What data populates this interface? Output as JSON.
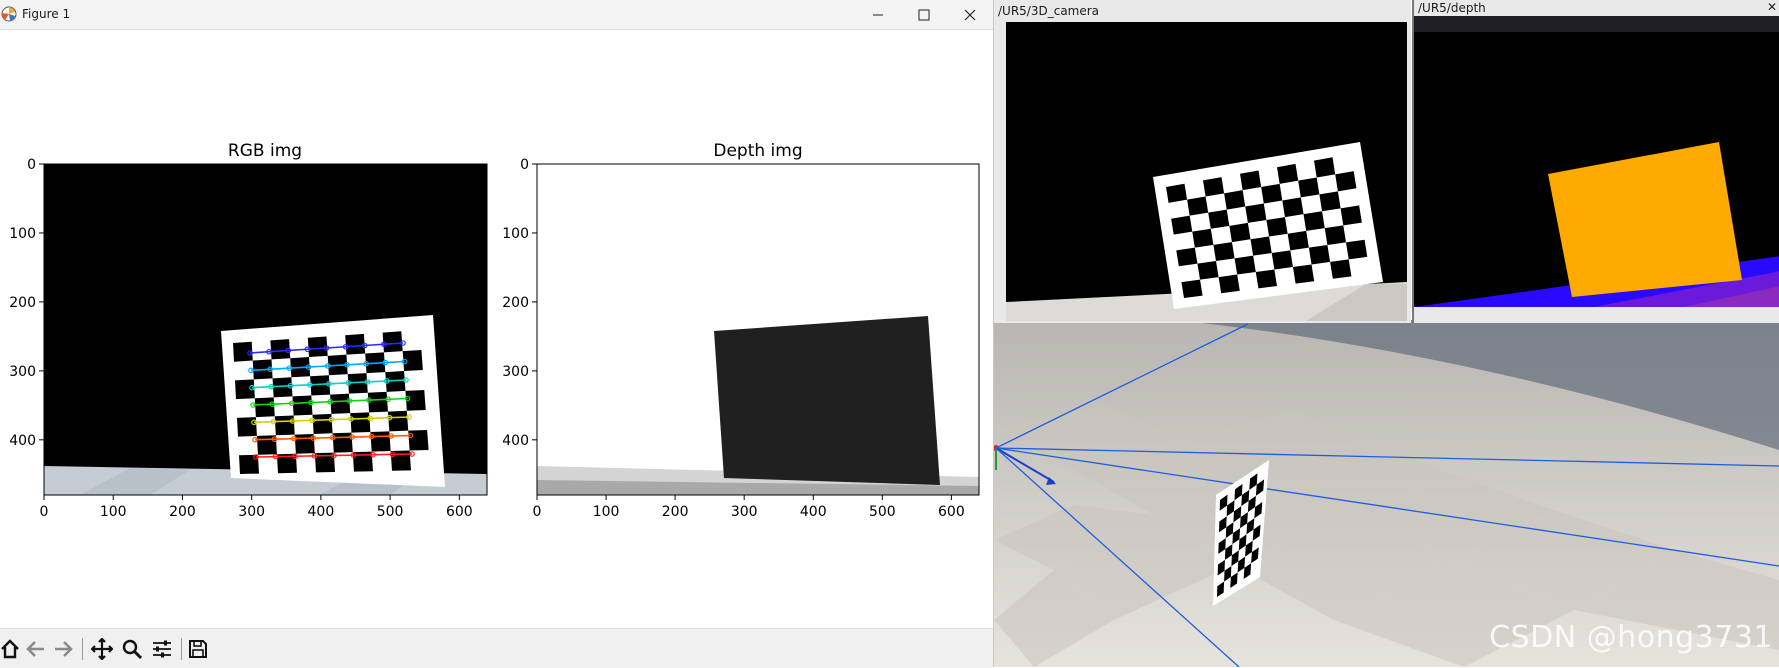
{
  "figure_window": {
    "title": "Figure 1",
    "controls": [
      "minimize",
      "maximize",
      "close"
    ],
    "app_icon": "matplotlib-icon"
  },
  "chart_data": [
    {
      "type": "image",
      "title": "RGB img",
      "xticks": [
        "0",
        "100",
        "200",
        "300",
        "400",
        "500",
        "600"
      ],
      "yticks": [
        "0",
        "100",
        "200",
        "300",
        "400"
      ],
      "xlim": [
        0,
        640
      ],
      "ylim": [
        480,
        0
      ],
      "content": "camera view of a checkerboard with detected corners drawn in rainbow colours"
    },
    {
      "type": "image",
      "title": "Depth img",
      "xticks": [
        "0",
        "100",
        "200",
        "300",
        "400",
        "500",
        "600"
      ],
      "yticks": [
        "0",
        "100",
        "200",
        "300",
        "400"
      ],
      "xlim": [
        0,
        640
      ],
      "ylim": [
        480,
        0
      ],
      "content": "depth view showing the board as a dark quadrilateral on a white background"
    }
  ],
  "toolbar": {
    "buttons": [
      "home-icon",
      "back-icon",
      "forward-icon",
      "pan-icon",
      "zoom-icon",
      "configure-subplots-icon",
      "save-icon"
    ]
  },
  "camera_panel": {
    "title": "/UR5/3D_camera"
  },
  "depth_panel": {
    "title": "/UR5/depth",
    "close_glyph": "✕"
  },
  "watermark": {
    "text": "CSDN @hong3731"
  },
  "colors": {
    "depth_board": "#ffaa00",
    "scene_sky": "#7f858f",
    "floor": "#d9d5cf",
    "vision_lines": "#1a4fdc"
  }
}
